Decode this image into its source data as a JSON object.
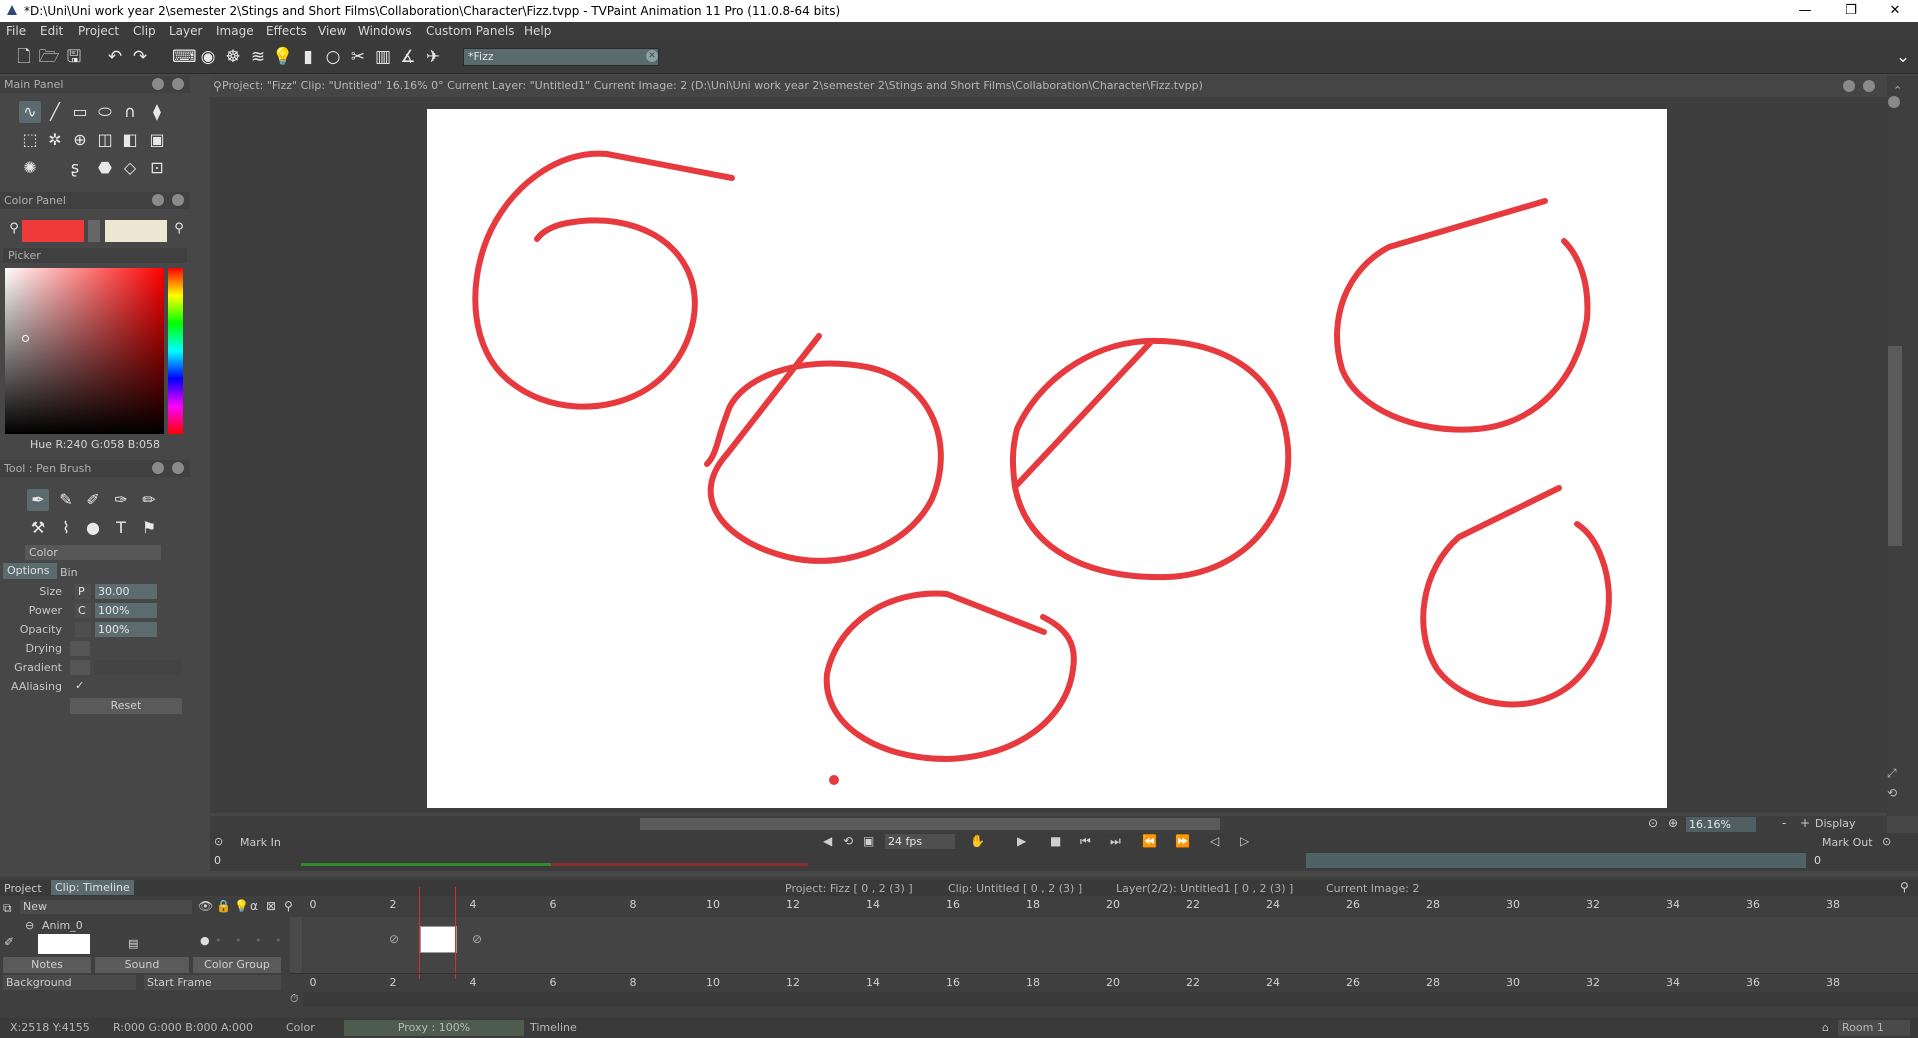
{
  "window": {
    "title": "*D:\\Uni\\Uni work year 2\\semester 2\\Stings and Short Films\\Collaboration\\Character\\Fizz.tvpp - TVPaint Animation 11 Pro (11.0.8-64 bits)",
    "minimize": "—",
    "restore": "❐",
    "close": "✕"
  },
  "menu": [
    "File",
    "Edit",
    "Project",
    "Clip",
    "Layer",
    "Image",
    "Effects",
    "View",
    "Windows",
    "Custom Panels",
    "Help"
  ],
  "search": {
    "value": "*Fizz"
  },
  "main_panel": {
    "title": "Main Panel"
  },
  "color_panel": {
    "title": "Color Panel",
    "primary_color": "#ef3a3a",
    "secondary_color": "#ede6d2",
    "picker_label": "Picker",
    "readout": "Hue R:240 G:058 B:058"
  },
  "tool_panel": {
    "title": "Tool : Pen Brush",
    "mode": "Color",
    "tabs": [
      "Options",
      "Bin"
    ],
    "fields": [
      {
        "label": "Size",
        "prefix": "P",
        "value": "30.00"
      },
      {
        "label": "Power",
        "prefix": "C",
        "value": "100%"
      },
      {
        "label": "Opacity",
        "prefix": "",
        "value": "100%"
      },
      {
        "label": "Drying",
        "prefix": "",
        "value": ""
      },
      {
        "label": "Gradient",
        "prefix": "",
        "value": ""
      },
      {
        "label": "AAliasing",
        "prefix": "",
        "value": "✓"
      }
    ],
    "reset": "Reset"
  },
  "canvas_info": "Project: \"Fizz\"  Clip: \"Untitled\"   16.16%   0°  Current Layer: \"Untitled1\"  Current Image: 2 (D:\\Uni\\Uni work year 2\\semester 2\\Stings and Short Films\\Collaboration\\Character\\Fizz.tvpp)",
  "stroke_color": "#e63a3f",
  "playback": {
    "mark_in": "Mark In",
    "fps": "24 fps",
    "zoom": "16.16%",
    "display": "Display",
    "mark_out": "Mark Out",
    "in_value": "0",
    "out_value": "0"
  },
  "timeline": {
    "tabs": [
      "Project",
      "Clip: Timeline"
    ],
    "info": [
      "Project: Fizz [ 0 , 2  (3) ]",
      "Clip: Untitled [ 0 , 2  (3) ]",
      "Layer(2/2): Untitled1 [ 0 , 2  (3) ]",
      "Current Image: 2"
    ],
    "new_label": "New",
    "layer_name": "Anim_0",
    "buttons": [
      "Notes",
      "Sound",
      "Color Group"
    ],
    "background": "Background",
    "start_frame": "Start Frame",
    "frame_numbers": [
      "0",
      "2",
      "4",
      "6",
      "8",
      "10",
      "12",
      "14",
      "16",
      "18",
      "20",
      "22",
      "24",
      "26",
      "28",
      "30",
      "32",
      "34",
      "36",
      "38"
    ]
  },
  "status": {
    "coords": "X:2518  Y:4155",
    "rgba": "R:000 G:000 B:000 A:000",
    "mode": "Color",
    "proxy": "Proxy : 100%",
    "view": "Timeline",
    "room": "Room 1"
  }
}
